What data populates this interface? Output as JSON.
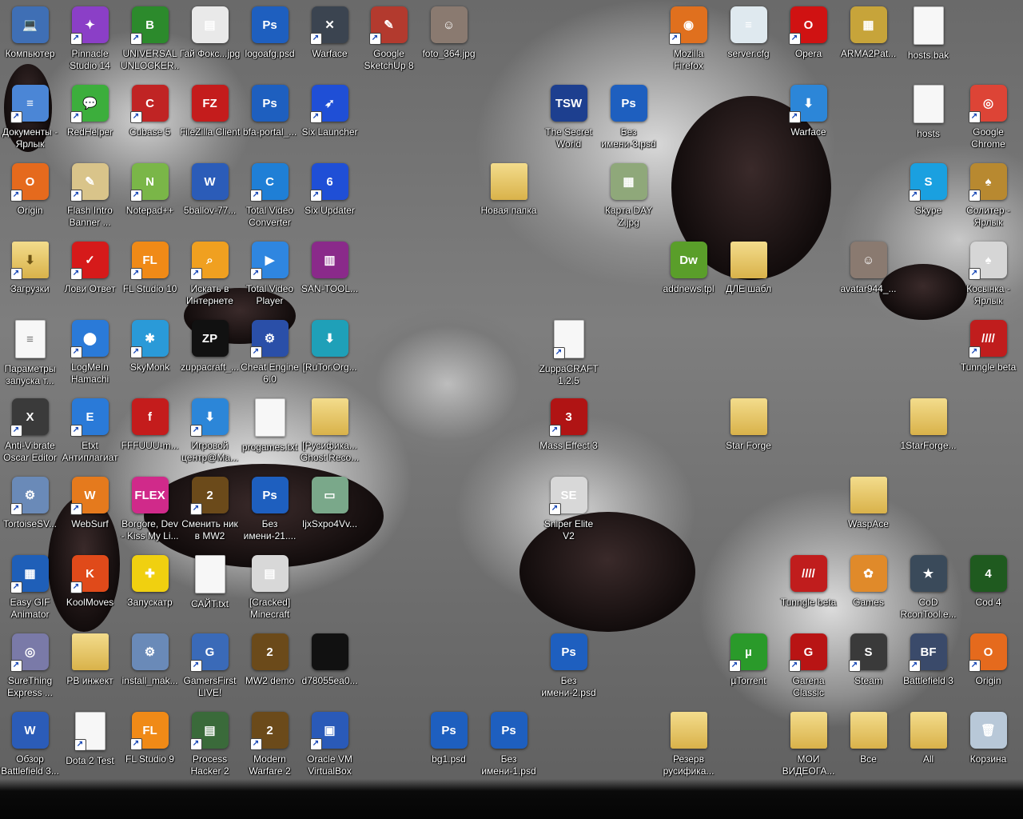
{
  "desktop": {
    "icons": [
      {
        "label": "Компьютер",
        "symbol": "💻",
        "color": "#3f6fb5",
        "col": 0,
        "row": 0,
        "shortcut": false
      },
      {
        "label": "Pinnacle Studio 14",
        "symbol": "✦",
        "color": "#8b3fc7",
        "col": 1,
        "row": 0,
        "shortcut": true
      },
      {
        "label": "UNIVERSAL UNLOCKER...",
        "symbol": "B",
        "color": "#2c8a2c",
        "col": 2,
        "row": 0,
        "shortcut": true
      },
      {
        "label": "Гай Фокс...jpg",
        "symbol": "▤",
        "color": "#e9e9e9",
        "col": 3,
        "row": 0,
        "shortcut": false
      },
      {
        "label": "logoafg.psd",
        "symbol": "Ps",
        "color": "#1e5fbf",
        "col": 4,
        "row": 0,
        "shortcut": false
      },
      {
        "label": "Warface",
        "symbol": "✕",
        "color": "#3b4450",
        "col": 5,
        "row": 0,
        "shortcut": true
      },
      {
        "label": "Google SketchUp 8",
        "symbol": "✎",
        "color": "#b33a2e",
        "col": 6,
        "row": 0,
        "shortcut": true
      },
      {
        "label": "foto_364.jpg",
        "symbol": "☺",
        "color": "#8a7a70",
        "col": 7,
        "row": 0,
        "shortcut": false
      },
      {
        "label": "Mozilla Firefox",
        "symbol": "◉",
        "color": "#e0701e",
        "col": 11,
        "row": 0,
        "shortcut": true
      },
      {
        "label": "server.cfg",
        "symbol": "≡",
        "color": "#dfe9ef",
        "col": 12,
        "row": 0,
        "shortcut": false
      },
      {
        "label": "Opera",
        "symbol": "O",
        "color": "#d01212",
        "col": 13,
        "row": 0,
        "shortcut": true
      },
      {
        "label": "ARMA2Pat...",
        "symbol": "▦",
        "color": "#c7a43a",
        "col": 14,
        "row": 0,
        "shortcut": false
      },
      {
        "label": "hosts.bak",
        "symbol": "",
        "color": "#f5f5f5",
        "col": 15,
        "row": 0,
        "shortcut": false
      },
      {
        "label": "Документы - Ярлык",
        "symbol": "≡",
        "color": "#4b86d6",
        "col": 0,
        "row": 1,
        "shortcut": true
      },
      {
        "label": "RedHelper",
        "symbol": "💬",
        "color": "#3cae3c",
        "col": 1,
        "row": 1,
        "shortcut": true
      },
      {
        "label": "Cubase 5",
        "symbol": "C",
        "color": "#c02424",
        "col": 2,
        "row": 1,
        "shortcut": true
      },
      {
        "label": "FileZilla Client",
        "symbol": "FZ",
        "color": "#c41c1c",
        "col": 3,
        "row": 1,
        "shortcut": false
      },
      {
        "label": "bfa-portal_...",
        "symbol": "Ps",
        "color": "#1e5fbf",
        "col": 4,
        "row": 1,
        "shortcut": false
      },
      {
        "label": "Six Launcher",
        "symbol": "➶",
        "color": "#1f4fd6",
        "col": 5,
        "row": 1,
        "shortcut": true
      },
      {
        "label": "The Secret World",
        "symbol": "TSW",
        "color": "#1d3f8f",
        "col": 9,
        "row": 1,
        "shortcut": false
      },
      {
        "label": "Без имени-3.psd",
        "symbol": "Ps",
        "color": "#1e5fbf",
        "col": 10,
        "row": 1,
        "shortcut": false
      },
      {
        "label": "Warface",
        "symbol": "⬇",
        "color": "#2c86d8",
        "col": 13,
        "row": 1,
        "shortcut": true
      },
      {
        "label": "hosts",
        "symbol": "",
        "color": "#f5f5f5",
        "col": 15,
        "row": 1,
        "shortcut": false
      },
      {
        "label": "Google Chrome",
        "symbol": "◎",
        "color": "#dd4436",
        "col": 16,
        "row": 1,
        "shortcut": true
      },
      {
        "label": "Origin",
        "symbol": "O",
        "color": "#e56a1d",
        "col": 0,
        "row": 2,
        "shortcut": true
      },
      {
        "label": "Flash Intro Banner ...",
        "symbol": "✎",
        "color": "#d9c48a",
        "col": 1,
        "row": 2,
        "shortcut": true
      },
      {
        "label": "Notepad++",
        "symbol": "N",
        "color": "#7ab648",
        "col": 2,
        "row": 2,
        "shortcut": true
      },
      {
        "label": "5ballov-77...",
        "symbol": "W",
        "color": "#2b5cb8",
        "col": 3,
        "row": 2,
        "shortcut": false
      },
      {
        "label": "Total Video Converter",
        "symbol": "C",
        "color": "#1f7fd6",
        "col": 4,
        "row": 2,
        "shortcut": true
      },
      {
        "label": "Six Updater",
        "symbol": "6",
        "color": "#1f4fd6",
        "col": 5,
        "row": 2,
        "shortcut": true
      },
      {
        "label": "Новая папка",
        "symbol": "",
        "color": "#e6c466",
        "col": 8,
        "row": 2,
        "shortcut": false
      },
      {
        "label": "Карта DAY Z.jpg",
        "symbol": "▦",
        "color": "#8fa87a",
        "col": 10,
        "row": 2,
        "shortcut": false
      },
      {
        "label": "Skype",
        "symbol": "S",
        "color": "#1aa0e0",
        "col": 15,
        "row": 2,
        "shortcut": true
      },
      {
        "label": "Солитер - Ярлык",
        "symbol": "♠",
        "color": "#b88930",
        "col": 16,
        "row": 2,
        "shortcut": true
      },
      {
        "label": "Загрузки",
        "symbol": "⬇",
        "color": "#e6c466",
        "col": 0,
        "row": 3,
        "shortcut": true
      },
      {
        "label": "Лови Ответ",
        "symbol": "✓",
        "color": "#d61a1a",
        "col": 1,
        "row": 3,
        "shortcut": true
      },
      {
        "label": "FL Studio 10",
        "symbol": "FL",
        "color": "#f08a17",
        "col": 2,
        "row": 3,
        "shortcut": true
      },
      {
        "label": "Искать в Интернете",
        "symbol": "⌕",
        "color": "#f0a020",
        "col": 3,
        "row": 3,
        "shortcut": true
      },
      {
        "label": "Total Video Player",
        "symbol": "▶",
        "color": "#2f86e0",
        "col": 4,
        "row": 3,
        "shortcut": true
      },
      {
        "label": "SAN-TOOL...",
        "symbol": "▥",
        "color": "#8a2a8a",
        "col": 5,
        "row": 3,
        "shortcut": false
      },
      {
        "label": "addnews.tpl",
        "symbol": "Dw",
        "color": "#5a9e2a",
        "col": 11,
        "row": 3,
        "shortcut": false
      },
      {
        "label": "ДЛЕ шабл",
        "symbol": "",
        "color": "#e6c466",
        "col": 12,
        "row": 3,
        "shortcut": false
      },
      {
        "label": "avatar944_...",
        "symbol": "☺",
        "color": "#8a7a70",
        "col": 14,
        "row": 3,
        "shortcut": false
      },
      {
        "label": "Косынка - Ярлык",
        "symbol": "♠",
        "color": "#d6d6d6",
        "col": 16,
        "row": 3,
        "shortcut": true
      },
      {
        "label": "Параметры запуска т...",
        "symbol": "≡",
        "color": "#f2f2f2",
        "col": 0,
        "row": 4,
        "shortcut": false
      },
      {
        "label": "LogMeIn Hamachi",
        "symbol": "⬤",
        "color": "#2a7ad8",
        "col": 1,
        "row": 4,
        "shortcut": true
      },
      {
        "label": "SkyMonk",
        "symbol": "✱",
        "color": "#2a9ad8",
        "col": 2,
        "row": 4,
        "shortcut": true
      },
      {
        "label": "zuppacraft_...",
        "symbol": "ZP",
        "color": "#111111",
        "col": 3,
        "row": 4,
        "shortcut": false
      },
      {
        "label": "Cheat Engine 6.0",
        "symbol": "⚙",
        "color": "#2a4fa8",
        "col": 4,
        "row": 4,
        "shortcut": true
      },
      {
        "label": "[RuTor.Org...",
        "symbol": "⬇",
        "color": "#1fa0b8",
        "col": 5,
        "row": 4,
        "shortcut": false
      },
      {
        "label": "ZuppaCRAFT 1.2.5",
        "symbol": "",
        "color": "#f5f5f5",
        "col": 9,
        "row": 4,
        "shortcut": true
      },
      {
        "label": "Tunngle beta",
        "symbol": "////",
        "color": "#c01d1d",
        "col": 16,
        "row": 4,
        "shortcut": true
      },
      {
        "label": "Anti-Vibrate Oscar Editor",
        "symbol": "X",
        "color": "#3a3a3a",
        "col": 0,
        "row": 5,
        "shortcut": true
      },
      {
        "label": "Etxt Антиплагиат",
        "symbol": "E",
        "color": "#2a7ad8",
        "col": 1,
        "row": 5,
        "shortcut": true
      },
      {
        "label": "FFFUUU-m...",
        "symbol": "f",
        "color": "#c41c1c",
        "col": 2,
        "row": 5,
        "shortcut": false
      },
      {
        "label": "Игровой центр@Ma...",
        "symbol": "⬇",
        "color": "#2c86d8",
        "col": 3,
        "row": 5,
        "shortcut": true
      },
      {
        "label": "progames.txt",
        "symbol": "",
        "color": "#f5f5f5",
        "col": 4,
        "row": 5,
        "shortcut": false
      },
      {
        "label": "[Русифика... Ghost Reco...",
        "symbol": "",
        "color": "#e6c466",
        "col": 5,
        "row": 5,
        "shortcut": false
      },
      {
        "label": "Mass Effect 3",
        "symbol": "3",
        "color": "#b01414",
        "col": 9,
        "row": 5,
        "shortcut": true
      },
      {
        "label": "Star Forge",
        "symbol": "",
        "color": "#e6c466",
        "col": 12,
        "row": 5,
        "shortcut": false
      },
      {
        "label": "1StarForge...",
        "symbol": "",
        "color": "#e6c466",
        "col": 15,
        "row": 5,
        "shortcut": false
      },
      {
        "label": "TortoiseSV...",
        "symbol": "⚙",
        "color": "#6a8ab8",
        "col": 0,
        "row": 6,
        "shortcut": true
      },
      {
        "label": "WebSurf",
        "symbol": "W",
        "color": "#e57a1d",
        "col": 1,
        "row": 6,
        "shortcut": true
      },
      {
        "label": "Borgore, Dev - Kiss My Li...",
        "symbol": "FLEX",
        "color": "#d02a8a",
        "col": 2,
        "row": 6,
        "shortcut": false
      },
      {
        "label": "Сменить ник в MW2",
        "symbol": "2",
        "color": "#6b4a1a",
        "col": 3,
        "row": 6,
        "shortcut": true
      },
      {
        "label": "Без имени-21....",
        "symbol": "Ps",
        "color": "#1e5fbf",
        "col": 4,
        "row": 6,
        "shortcut": false
      },
      {
        "label": "IjxSxpo4Vv...",
        "symbol": "▭",
        "color": "#7aa88a",
        "col": 5,
        "row": 6,
        "shortcut": false
      },
      {
        "label": "Sniper Elite V2",
        "symbol": "SE",
        "color": "#d8d8d8",
        "col": 9,
        "row": 6,
        "shortcut": true
      },
      {
        "label": "WaspAce",
        "symbol": "",
        "color": "#e6c466",
        "col": 14,
        "row": 6,
        "shortcut": false
      },
      {
        "label": "Easy GIF Animator",
        "symbol": "▦",
        "color": "#1f5fb8",
        "col": 0,
        "row": 7,
        "shortcut": true
      },
      {
        "label": "KoolMoves",
        "symbol": "K",
        "color": "#e04a1a",
        "col": 1,
        "row": 7,
        "shortcut": true
      },
      {
        "label": "Запускатр",
        "symbol": "✚",
        "color": "#f0d010",
        "col": 2,
        "row": 7,
        "shortcut": false
      },
      {
        "label": "САЙТ.txt",
        "symbol": "",
        "color": "#f5f5f5",
        "col": 3,
        "row": 7,
        "shortcut": false
      },
      {
        "label": "[Cracked] Minecraft",
        "symbol": "▤",
        "color": "#d8d8d8",
        "col": 4,
        "row": 7,
        "shortcut": false
      },
      {
        "label": "Tunngle beta",
        "symbol": "////",
        "color": "#c01d1d",
        "col": 13,
        "row": 7,
        "shortcut": false
      },
      {
        "label": "Games",
        "symbol": "✿",
        "color": "#e08a2a",
        "col": 14,
        "row": 7,
        "shortcut": false
      },
      {
        "label": "CoD RconTool.e...",
        "symbol": "★",
        "color": "#3a4a5a",
        "col": 15,
        "row": 7,
        "shortcut": false
      },
      {
        "label": "Cod 4",
        "symbol": "4",
        "color": "#1f5a1f",
        "col": 16,
        "row": 7,
        "shortcut": false
      },
      {
        "label": "SureThing Express ...",
        "symbol": "◎",
        "color": "#7a7aa8",
        "col": 0,
        "row": 8,
        "shortcut": true
      },
      {
        "label": "PB инжект",
        "symbol": "",
        "color": "#e6c466",
        "col": 1,
        "row": 8,
        "shortcut": false
      },
      {
        "label": "install_mak...",
        "symbol": "⚙",
        "color": "#6a8ab8",
        "col": 2,
        "row": 8,
        "shortcut": false
      },
      {
        "label": "GamersFirst LIVE!",
        "symbol": "G",
        "color": "#3a6ab8",
        "col": 3,
        "row": 8,
        "shortcut": true
      },
      {
        "label": "MW2 demo",
        "symbol": "2",
        "color": "#6b4a1a",
        "col": 4,
        "row": 8,
        "shortcut": false
      },
      {
        "label": "d78055ea0...",
        "symbol": "",
        "color": "#111111",
        "col": 5,
        "row": 8,
        "shortcut": false
      },
      {
        "label": "Без имени-2.psd",
        "symbol": "Ps",
        "color": "#1e5fbf",
        "col": 9,
        "row": 8,
        "shortcut": false
      },
      {
        "label": "µTorrent",
        "symbol": "µ",
        "color": "#2a9a2a",
        "col": 12,
        "row": 8,
        "shortcut": true
      },
      {
        "label": "Garena Classic",
        "symbol": "G",
        "color": "#b81414",
        "col": 13,
        "row": 8,
        "shortcut": true
      },
      {
        "label": "Steam",
        "symbol": "S",
        "color": "#3a3a3a",
        "col": 14,
        "row": 8,
        "shortcut": true
      },
      {
        "label": "Battlefield 3",
        "symbol": "BF",
        "color": "#3a4a6a",
        "col": 15,
        "row": 8,
        "shortcut": true
      },
      {
        "label": "Origin",
        "symbol": "O",
        "color": "#e56a1d",
        "col": 16,
        "row": 8,
        "shortcut": true
      },
      {
        "label": "Обзор Battlefield 3...",
        "symbol": "W",
        "color": "#2b5cb8",
        "col": 0,
        "row": 9,
        "shortcut": false
      },
      {
        "label": "Dota 2 Test",
        "symbol": "",
        "color": "#f5f5f5",
        "col": 1,
        "row": 9,
        "shortcut": true
      },
      {
        "label": "FL Studio 9",
        "symbol": "FL",
        "color": "#f08a17",
        "col": 2,
        "row": 9,
        "shortcut": true
      },
      {
        "label": "Process Hacker 2",
        "symbol": "▤",
        "color": "#3a6a3a",
        "col": 3,
        "row": 9,
        "shortcut": true
      },
      {
        "label": "Modern Warfare 2",
        "symbol": "2",
        "color": "#6b4a1a",
        "col": 4,
        "row": 9,
        "shortcut": true
      },
      {
        "label": "Oracle VM VirtualBox",
        "symbol": "▣",
        "color": "#2a5ab8",
        "col": 5,
        "row": 9,
        "shortcut": true
      },
      {
        "label": "bg1.psd",
        "symbol": "Ps",
        "color": "#1e5fbf",
        "col": 7,
        "row": 9,
        "shortcut": false
      },
      {
        "label": "Без имени-1.psd",
        "symbol": "Ps",
        "color": "#1e5fbf",
        "col": 8,
        "row": 9,
        "shortcut": false
      },
      {
        "label": "Резерв русифика...",
        "symbol": "",
        "color": "#e6c466",
        "col": 11,
        "row": 9,
        "shortcut": false
      },
      {
        "label": "МОИ ВИДЕОГА...",
        "symbol": "",
        "color": "#e6c466",
        "col": 13,
        "row": 9,
        "shortcut": false
      },
      {
        "label": "Все",
        "symbol": "",
        "color": "#e6c466",
        "col": 14,
        "row": 9,
        "shortcut": false
      },
      {
        "label": "All",
        "symbol": "",
        "color": "#e6c466",
        "col": 15,
        "row": 9,
        "shortcut": false
      },
      {
        "label": "Корзина",
        "symbol": "🗑",
        "color": "#b8c8d8",
        "col": 16,
        "row": 9,
        "shortcut": false
      }
    ]
  }
}
